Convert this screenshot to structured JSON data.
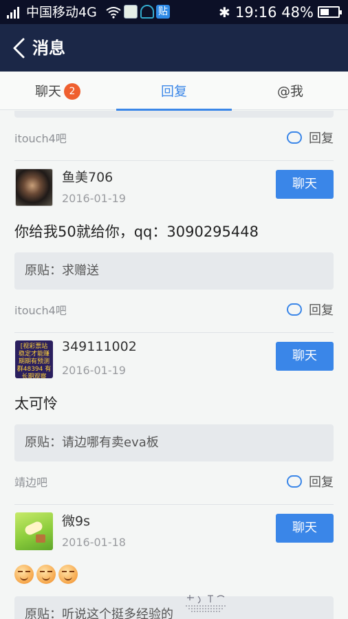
{
  "status_bar": {
    "carrier": "中国移动4G",
    "tieba_icon": "贴",
    "time": "19:16",
    "battery": "48%",
    "battery_level": 0.48,
    "icons": [
      "signal-icon",
      "wifi-icon",
      "notes-icon",
      "headset-icon",
      "tieba-icon",
      "bluetooth-icon",
      "battery-icon"
    ]
  },
  "app_bar": {
    "title": "消息",
    "back_icon": "chevron-left-icon"
  },
  "tabs": [
    {
      "label": "聊天",
      "badge": "2"
    },
    {
      "label": "回复",
      "active": true
    },
    {
      "label": "@我"
    }
  ],
  "items": [
    {
      "forum": "itouch4吧",
      "reply_label": "回复",
      "username": "鱼美706",
      "date": "2016-01-19",
      "chat_label": "聊天",
      "content": "你给我50就给你，qq：3090295448",
      "original": "原贴：求赠送"
    },
    {
      "forum": "itouch4吧",
      "reply_label": "回复",
      "username": "349111002",
      "date": "2016-01-19",
      "chat_label": "聊天",
      "content": "太可怜",
      "original": "原贴：请边哪有卖eva板",
      "avatar_text": "[视彩票站 稳定才能赚 期期有预测 群48394 有长期观察"
    },
    {
      "forum": "靖边吧",
      "reply_label": "回复",
      "username": "微9s",
      "date": "2016-01-18",
      "chat_label": "聊天",
      "content_emoji_count": 3,
      "original": "原贴：听说这个挺多经验的"
    }
  ],
  "colors": {
    "accent": "#3a86e8",
    "header": "#1b2747",
    "statusbar": "#0c1027",
    "badge": "#ef5f2f"
  }
}
